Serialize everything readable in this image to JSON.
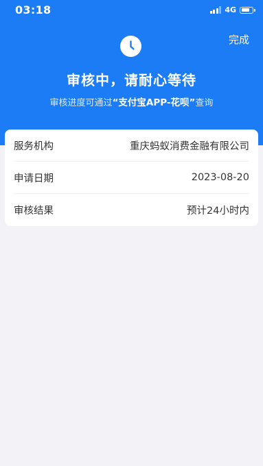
{
  "status_bar": {
    "time": "03:18",
    "network": "4G"
  },
  "header": {
    "done_label": "完成",
    "title": "审核中，请耐心等待",
    "subtitle_prefix": "审核进度可通过",
    "subtitle_highlight": "“支付宝APP-花呗”",
    "subtitle_suffix": "查询",
    "icon": "clock-icon"
  },
  "details": [
    {
      "label": "服务机构",
      "value": "重庆蚂蚁消费金融有限公司"
    },
    {
      "label": "申请日期",
      "value": "2023-08-20"
    },
    {
      "label": "审核结果",
      "value": "预计24小时内"
    }
  ],
  "colors": {
    "primary": "#1b7cf6",
    "page_background": "#f3f3f7",
    "card_background": "#ffffff",
    "text": "#333333"
  }
}
